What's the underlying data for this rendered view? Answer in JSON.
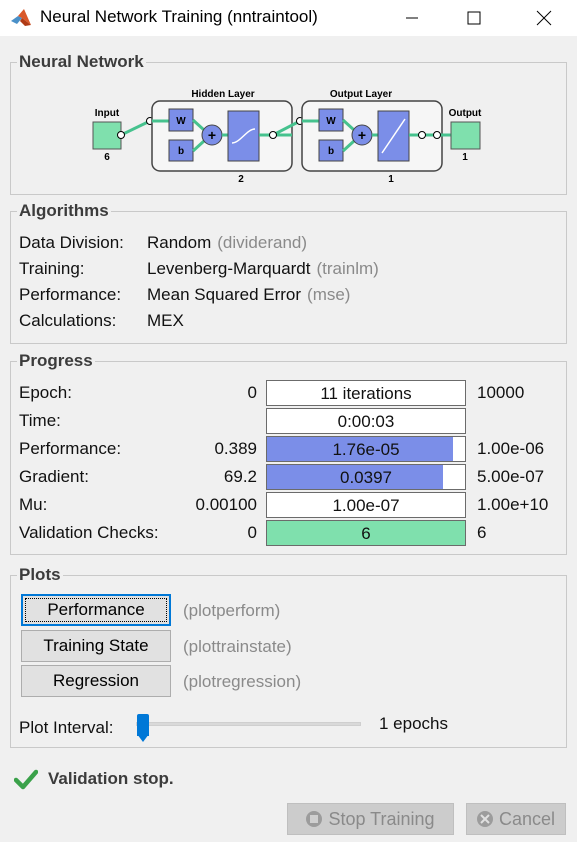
{
  "window": {
    "title": "Neural Network Training (nntraintool)"
  },
  "network": {
    "heading": "Neural Network",
    "input_label": "Input",
    "input_size": "6",
    "hidden_label": "Hidden Layer",
    "hidden_size": "2",
    "output_layer_label": "Output Layer",
    "output_layer_size": "1",
    "output_label": "Output",
    "output_size": "1",
    "w": "W",
    "b": "b"
  },
  "algorithms": {
    "heading": "Algorithms",
    "rows": [
      {
        "label": "Data Division:",
        "value": "Random",
        "func": "(dividerand)"
      },
      {
        "label": "Training:",
        "value": "Levenberg-Marquardt",
        "func": "(trainlm)"
      },
      {
        "label": "Performance:",
        "value": "Mean Squared Error",
        "func": "(mse)"
      },
      {
        "label": "Calculations:",
        "value": "MEX",
        "func": ""
      }
    ]
  },
  "progress": {
    "heading": "Progress",
    "rows": [
      {
        "label": "Epoch:",
        "min": "0",
        "value": "11 iterations",
        "max": "10000",
        "fill": 0.0,
        "color": "#ffffff"
      },
      {
        "label": "Time:",
        "min": "",
        "value": "0:00:03",
        "max": "",
        "fill": 0.0,
        "color": "#ffffff"
      },
      {
        "label": "Performance:",
        "min": "0.389",
        "value": "1.76e-05",
        "max": "1.00e-06",
        "fill": 0.94,
        "color": "#7b8ee8"
      },
      {
        "label": "Gradient:",
        "min": "69.2",
        "value": "0.0397",
        "max": "5.00e-07",
        "fill": 0.89,
        "color": "#7b8ee8"
      },
      {
        "label": "Mu:",
        "min": "0.00100",
        "value": "1.00e-07",
        "max": "1.00e+10",
        "fill": 0.0,
        "color": "#ffffff"
      },
      {
        "label": "Validation Checks:",
        "min": "0",
        "value": "6",
        "max": "6",
        "fill": 1.0,
        "color": "#7fe0ad"
      }
    ]
  },
  "plots": {
    "heading": "Plots",
    "buttons": [
      {
        "label": "Performance",
        "func": "(plotperform)"
      },
      {
        "label": "Training State",
        "func": "(plottrainstate)"
      },
      {
        "label": "Regression",
        "func": "(plotregression)"
      }
    ],
    "interval_label": "Plot Interval:",
    "interval_value": "1 epochs",
    "interval_fraction": 0.0
  },
  "status": {
    "text": "Validation stop."
  },
  "footer": {
    "stop_label": "Stop Training",
    "cancel_label": "Cancel"
  }
}
